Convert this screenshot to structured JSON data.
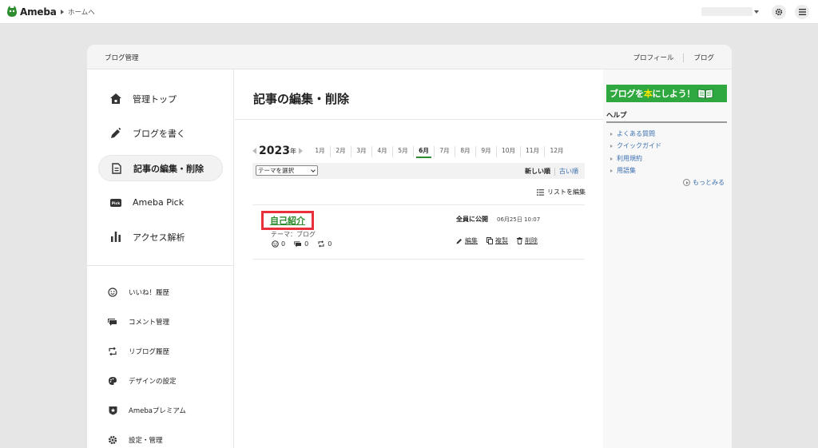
{
  "topbar": {
    "logo_text": "Ameba",
    "home_link": "ホームへ"
  },
  "panel": {
    "breadcrumb": "ブログ管理",
    "head_links": [
      "プロフィール",
      "ブログ"
    ]
  },
  "sidebar": {
    "main_items": [
      {
        "label": "管理トップ",
        "icon": "home-icon"
      },
      {
        "label": "ブログを書く",
        "icon": "pen-icon"
      },
      {
        "label": "記事の編集・削除",
        "icon": "document-icon",
        "active": true
      },
      {
        "label": "Ameba Pick",
        "icon": "pick-icon"
      },
      {
        "label": "アクセス解析",
        "icon": "bar-chart-icon"
      }
    ],
    "sub_items": [
      {
        "label": "いいね！履歴",
        "icon": "smile-icon"
      },
      {
        "label": "コメント管理",
        "icon": "comment-icon"
      },
      {
        "label": "リブログ履歴",
        "icon": "reblog-icon"
      },
      {
        "label": "デザインの設定",
        "icon": "palette-icon"
      },
      {
        "label": "Amebaプレミアム",
        "icon": "premium-shield-icon"
      },
      {
        "label": "設定・管理",
        "icon": "gear-icon"
      }
    ]
  },
  "main": {
    "title": "記事の編集・削除",
    "year": "2023",
    "year_suffix": "年",
    "months": [
      "1月",
      "2月",
      "3月",
      "4月",
      "5月",
      "6月",
      "7月",
      "8月",
      "9月",
      "10月",
      "11月",
      "12月"
    ],
    "active_month": "6月",
    "theme_select": "テーマを選択",
    "sort_new": "新しい順",
    "sort_old": "古い順",
    "edit_list": "リストを編集",
    "article": {
      "title": "自己紹介",
      "theme": "テーマ：ブログ",
      "likes": "0",
      "comments": "0",
      "reblogs": "0",
      "status": "全員に公開",
      "date": "06月25日 10:07",
      "edit": "編集",
      "copy": "複製",
      "delete": "削除"
    }
  },
  "right": {
    "banner_pre": "ブログを",
    "banner_hl": "本",
    "banner_post": "にしよう！",
    "help_title": "ヘルプ",
    "help_items": [
      "よくある質問",
      "クイックガイド",
      "利用規約",
      "用語集"
    ],
    "more": "もっとみる"
  },
  "colors": {
    "brand_green": "#2d8c2d",
    "highlight_red": "#e9303b",
    "link_blue": "#3a6fb0"
  }
}
